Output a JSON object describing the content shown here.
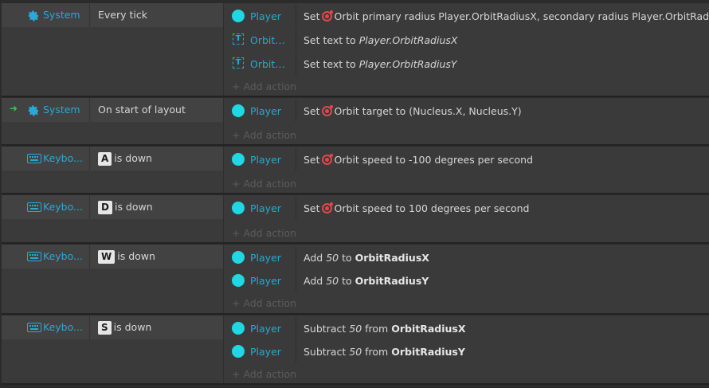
{
  "add_action_label": "+ Add action",
  "colors": {
    "object_name": "#2aa8d6",
    "sprite_icon": "#1fd8e4",
    "orbit_icon": "#e04848",
    "start_arrow": "#3cc25a"
  },
  "events": [
    {
      "condition": {
        "object": "System",
        "icon": "gear-icon",
        "text": "Every tick"
      },
      "actions": [
        {
          "object": "Player",
          "icon": "sprite-icon",
          "verb": "Set",
          "behavior_icon": "orbit-icon",
          "text": "Orbit primary radius Player.OrbitRadiusX, secondary radius Player.OrbitRadiusY"
        },
        {
          "object": "OrbitR...",
          "icon": "text-object-icon",
          "verb": "Set text to",
          "italic": "Player.OrbitRadiusX"
        },
        {
          "object": "OrbitR...",
          "icon": "text-object-icon",
          "verb": "Set text to",
          "italic": "Player.OrbitRadiusY"
        }
      ]
    },
    {
      "condition": {
        "object": "System",
        "icon": "gear-icon",
        "text": "On start of layout",
        "trigger_arrow": "➜"
      },
      "actions": [
        {
          "object": "Player",
          "icon": "sprite-icon",
          "verb": "Set",
          "behavior_icon": "orbit-icon",
          "text": "Orbit target to (Nucleus.X, Nucleus.Y)"
        }
      ]
    },
    {
      "condition": {
        "object": "Keybo...",
        "icon": "keyboard-icon",
        "key": "A",
        "text": "is down"
      },
      "actions": [
        {
          "object": "Player",
          "icon": "sprite-icon",
          "verb": "Set",
          "behavior_icon": "orbit-icon",
          "text": "Orbit speed to -100 degrees per second"
        }
      ]
    },
    {
      "condition": {
        "object": "Keybo...",
        "icon": "keyboard-icon",
        "key": "D",
        "text": "is down"
      },
      "actions": [
        {
          "object": "Player",
          "icon": "sprite-icon",
          "verb": "Set",
          "behavior_icon": "orbit-icon",
          "text": "Orbit speed to 100 degrees per second"
        }
      ]
    },
    {
      "condition": {
        "object": "Keybo...",
        "icon": "keyboard-icon",
        "key": "W",
        "text": "is down"
      },
      "actions": [
        {
          "object": "Player",
          "icon": "sprite-icon",
          "verb": "Add",
          "italic": "50",
          "mid": "to",
          "bold": "OrbitRadiusX"
        },
        {
          "object": "Player",
          "icon": "sprite-icon",
          "verb": "Add",
          "italic": "50",
          "mid": "to",
          "bold": "OrbitRadiusY"
        }
      ]
    },
    {
      "condition": {
        "object": "Keybo...",
        "icon": "keyboard-icon",
        "key": "S",
        "text": "is down"
      },
      "actions": [
        {
          "object": "Player",
          "icon": "sprite-icon",
          "verb": "Subtract",
          "italic": "50",
          "mid": "from",
          "bold": "OrbitRadiusX"
        },
        {
          "object": "Player",
          "icon": "sprite-icon",
          "verb": "Subtract",
          "italic": "50",
          "mid": "from",
          "bold": "OrbitRadiusY"
        }
      ]
    }
  ]
}
